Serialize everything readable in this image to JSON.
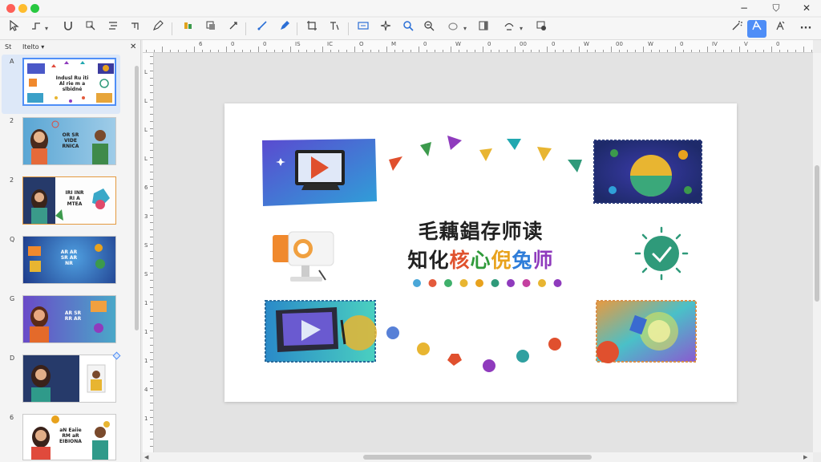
{
  "window": {
    "controls": {
      "minimize": "−",
      "shield": "⛉",
      "close": "✕"
    }
  },
  "toolbar": {
    "more_label": "···"
  },
  "panel": {
    "header_label": "St",
    "header_title": "Itelto ▾",
    "close_label": "✕",
    "slides": [
      {
        "num": "A",
        "text": "Indusl Ru iti\nAl rie m a\nslbidné"
      },
      {
        "num": "2",
        "text": "OR SR\nVIDE\nRNICA"
      },
      {
        "num": "2",
        "text": "IRI INR\nRI A\nMTEA"
      },
      {
        "num": "Q",
        "text": "AR AR\nSR AR\nNR"
      },
      {
        "num": "G",
        "text": "AR SR\nRR AR"
      },
      {
        "num": "D",
        "text": ""
      },
      {
        "num": "6",
        "text": "aN Eaiie\nRM aR\nEIBIONA"
      }
    ]
  },
  "ruler": {
    "h_labels": [
      "6",
      "0",
      "0",
      "IS",
      "IC",
      "O",
      "M",
      "0",
      "W",
      "0",
      "00",
      "0",
      "W",
      "00",
      "W",
      "0",
      "IV",
      "V",
      "0",
      "0"
    ],
    "v_labels": [
      "L",
      "L",
      "L",
      "L",
      "6",
      "3",
      "S",
      "S",
      "1",
      "1",
      "1",
      "4",
      "1"
    ]
  },
  "slide": {
    "title_line1": "毛藕錩存师读",
    "title_line2_chars": [
      {
        "ch": "知",
        "color": "#222222"
      },
      {
        "ch": "化",
        "color": "#222222"
      },
      {
        "ch": "核",
        "color": "#e0522e"
      },
      {
        "ch": "心",
        "color": "#2f9a3a"
      },
      {
        "ch": "倪",
        "color": "#e8a21d"
      },
      {
        "ch": "兔",
        "color": "#2f7dd9"
      },
      {
        "ch": "师",
        "color": "#8f3bbd"
      }
    ],
    "dot_colors": [
      "#4aa7d8",
      "#e45a3c",
      "#3fb06b",
      "#e8b531",
      "#e8a21d",
      "#2f9a7a",
      "#8f3bbd",
      "#c440a0",
      "#e8b531",
      "#8f3bbd"
    ]
  }
}
